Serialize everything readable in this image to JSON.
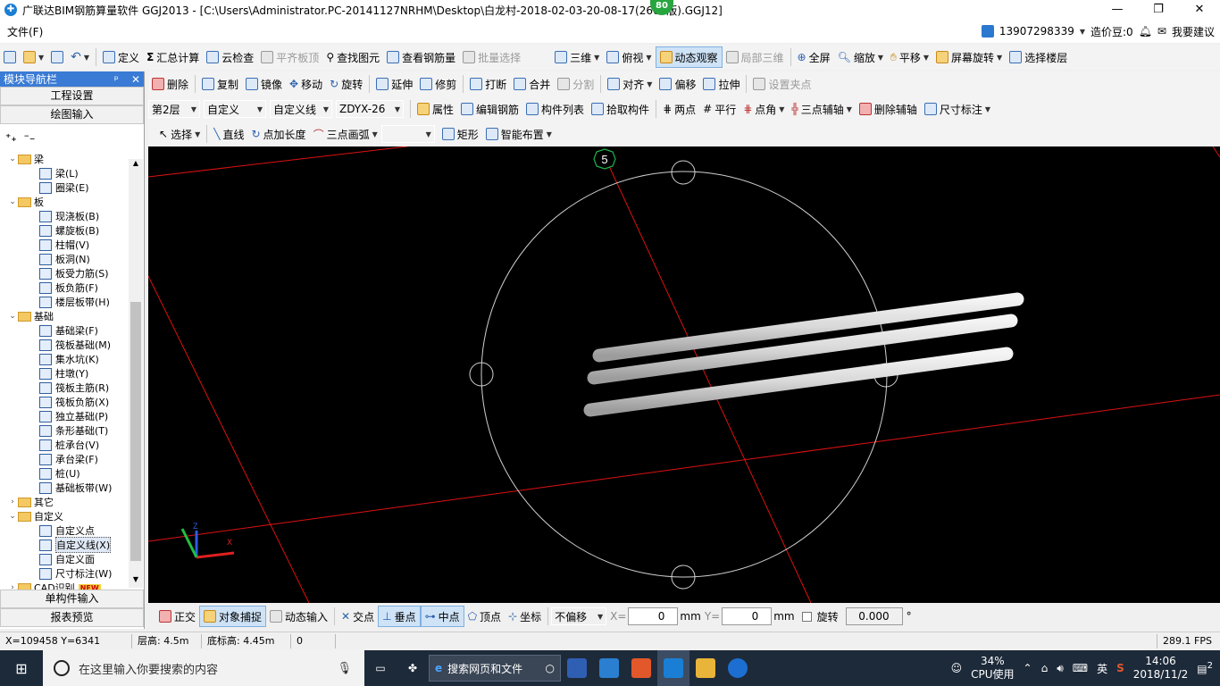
{
  "window": {
    "title": "广联达BIM钢筋算量软件 GGJ2013 - [C:\\Users\\Administrator.PC-20141127NRHM\\Desktop\\白龙村-2018-02-03-20-08-17(2660版).GGJ12]",
    "badge": "80",
    "minimize": "—",
    "maximize": "❐",
    "close": "✕"
  },
  "menu": {
    "file": "文件(F)",
    "phone": "13907298339",
    "coins": "造价豆:0",
    "suggest": "我要建议"
  },
  "toolbar1": {
    "define": "定义",
    "sum_calc": "汇总计算",
    "cloud_check": "云检查",
    "flat_top": "平齐板顶",
    "find_element": "查找图元",
    "view_rebar": "查看钢筋量",
    "batch_select": "批量选择",
    "three_d": "三维",
    "top_view": "俯视",
    "dynamic_view": "动态观察",
    "local_3d": "局部三维",
    "full_screen": "全屏",
    "zoom": "缩放",
    "pan": "平移",
    "screen_rotate": "屏幕旋转",
    "select_floor": "选择楼层"
  },
  "toolbar2": {
    "delete": "删除",
    "copy": "复制",
    "mirror": "镜像",
    "move": "移动",
    "rotate": "旋转",
    "extend": "延伸",
    "trim": "修剪",
    "break": "打断",
    "merge": "合并",
    "split": "分割",
    "align": "对齐",
    "offset": "偏移",
    "stretch": "拉伸",
    "set_grip": "设置夹点"
  },
  "toolbar3": {
    "floor": "第2层",
    "category": "自定义",
    "type": "自定义线",
    "name": "ZDYX-26",
    "property": "属性",
    "edit_rebar": "编辑钢筋",
    "component_list": "构件列表",
    "pick_component": "拾取构件",
    "two_points": "两点",
    "parallel": "平行",
    "point_angle": "点角",
    "three_point_axis": "三点辅轴",
    "delete_axis": "删除辅轴",
    "dimension": "尺寸标注"
  },
  "toolbar4": {
    "select": "选择",
    "line": "直线",
    "point_length": "点加长度",
    "three_point_arc": "三点画弧",
    "rectangle": "矩形",
    "smart_layout": "智能布置"
  },
  "nav": {
    "title": "模块导航栏",
    "pin": "ᵖ",
    "close": "✕",
    "project_settings": "工程设置",
    "drawing_input": "绘图输入",
    "single_input": "单构件输入",
    "report_preview": "报表预览",
    "tree": [
      {
        "level": 0,
        "toggle": "v",
        "label": "梁"
      },
      {
        "level": 1,
        "label": "梁(L)"
      },
      {
        "level": 1,
        "label": "圈梁(E)"
      },
      {
        "level": 0,
        "toggle": "v",
        "label": "板"
      },
      {
        "level": 1,
        "label": "现浇板(B)"
      },
      {
        "level": 1,
        "label": "螺旋板(B)"
      },
      {
        "level": 1,
        "label": "柱帽(V)"
      },
      {
        "level": 1,
        "label": "板洞(N)"
      },
      {
        "level": 1,
        "label": "板受力筋(S)"
      },
      {
        "level": 1,
        "label": "板负筋(F)"
      },
      {
        "level": 1,
        "label": "楼层板带(H)"
      },
      {
        "level": 0,
        "toggle": "v",
        "label": "基础"
      },
      {
        "level": 1,
        "label": "基础梁(F)"
      },
      {
        "level": 1,
        "label": "筏板基础(M)"
      },
      {
        "level": 1,
        "label": "集水坑(K)"
      },
      {
        "level": 1,
        "label": "柱墩(Y)"
      },
      {
        "level": 1,
        "label": "筏板主筋(R)"
      },
      {
        "level": 1,
        "label": "筏板负筋(X)"
      },
      {
        "level": 1,
        "label": "独立基础(P)"
      },
      {
        "level": 1,
        "label": "条形基础(T)"
      },
      {
        "level": 1,
        "label": "桩承台(V)"
      },
      {
        "level": 1,
        "label": "承台梁(F)"
      },
      {
        "level": 1,
        "label": "桩(U)"
      },
      {
        "level": 1,
        "label": "基础板带(W)"
      },
      {
        "level": 0,
        "toggle": ">",
        "label": "其它"
      },
      {
        "level": 0,
        "toggle": "v",
        "label": "自定义"
      },
      {
        "level": 1,
        "label": "自定义点"
      },
      {
        "level": 1,
        "label": "自定义线(X)"
      },
      {
        "level": 1,
        "label": "自定义面"
      },
      {
        "level": 1,
        "label": "尺寸标注(W)"
      },
      {
        "level": 0,
        "toggle": ">",
        "label": "CAD识别"
      }
    ],
    "new_tag": "NEW"
  },
  "viewport": {
    "axis_label": "5"
  },
  "statusbar": {
    "ortho": "正交",
    "object_snap": "对象捕捉",
    "dynamic_input": "动态输入",
    "intersection": "交点",
    "perpendicular": "垂点",
    "midpoint": "中点",
    "vertex": "顶点",
    "coordinate": "坐标",
    "no_offset": "不偏移",
    "x_label": "X=",
    "x_value": "0",
    "y_label": "Y=",
    "y_value": "0",
    "unit": "mm",
    "rotate": "旋转",
    "rotate_value": "0.000",
    "degree": "°"
  },
  "infobar": {
    "coords": "X=109458 Y=6341",
    "floor_height": "层高: 4.5m",
    "base_height": "底标高: 4.45m",
    "value": "0",
    "fps": "289.1 FPS"
  },
  "taskbar": {
    "search_placeholder": "在这里输入你要搜索的内容",
    "web_search": "搜索网页和文件",
    "cpu_percent": "34%",
    "cpu_label": "CPU使用",
    "ime": "英",
    "time": "14:06",
    "date": "2018/11/2",
    "notifications": "2"
  }
}
